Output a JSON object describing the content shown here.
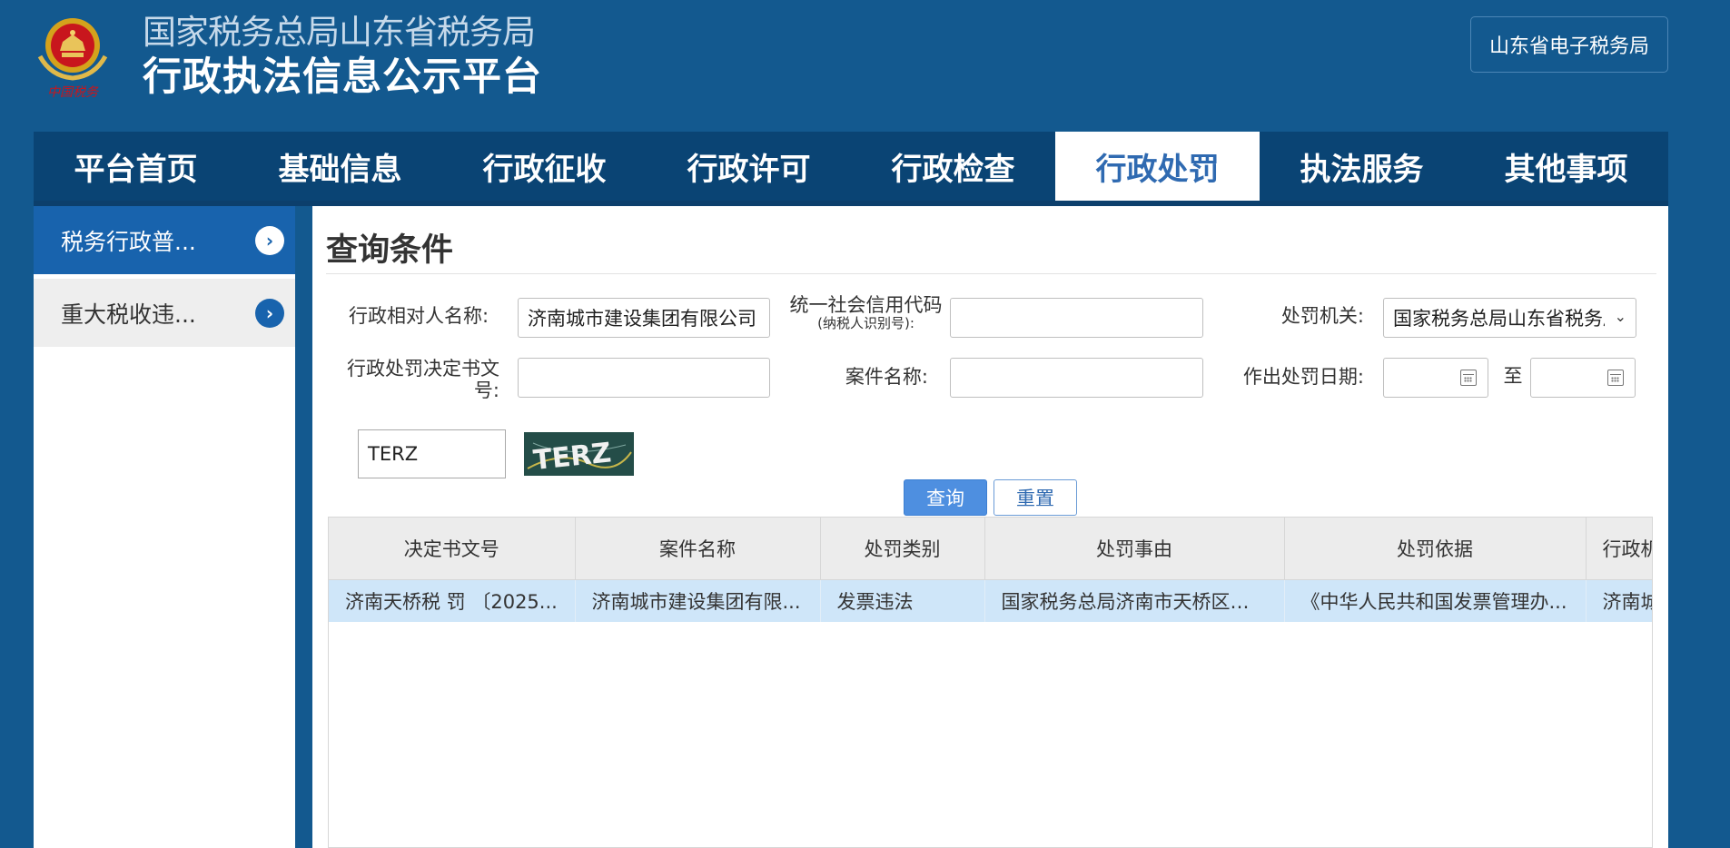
{
  "header": {
    "subtitle": "国家税务总局山东省税务局",
    "title": "行政执法信息公示平台",
    "emblem_text": "中国税务",
    "top_link": "山东省电子税务局"
  },
  "nav": {
    "items": [
      "平台首页",
      "基础信息",
      "行政征收",
      "行政许可",
      "行政检查",
      "行政处罚",
      "执法服务",
      "其他事项"
    ],
    "active": "行政处罚"
  },
  "sidebar": {
    "items": [
      {
        "label": "税务行政普..."
      },
      {
        "label": "重大税收违..."
      }
    ]
  },
  "search": {
    "title": "查询条件",
    "party_name_label": "行政相对人名称:",
    "party_name_value": "济南城市建设集团有限公司",
    "credit_code_label": "统一社会信用代码",
    "credit_code_sublabel": "(纳税人识别号):",
    "credit_code_value": "",
    "authority_label": "处罚机关:",
    "authority_value": "国家税务总局山东省税务局",
    "decision_no_label": "行政处罚决定书文号:",
    "decision_no_value": "",
    "case_name_label": "案件名称:",
    "case_name_value": "",
    "date_label": "作出处罚日期:",
    "date_separator": "至",
    "captcha_value": "TERZ",
    "captcha_image_text": "TERZ",
    "query_button": "查询",
    "reset_button": "重置"
  },
  "table": {
    "columns": [
      "决定书文号",
      "案件名称",
      "处罚类别",
      "处罚事由",
      "处罚依据",
      "行政机关"
    ],
    "rows": [
      [
        "济南天桥税 罚 〔2025...",
        "济南城市建设集团有限...",
        "发票违法",
        "国家税务总局济南市天桥区税...",
        "《中华人民共和国发票管理办...",
        "济南城..."
      ]
    ]
  },
  "colors": {
    "background": "#13598f",
    "nav": "#0a4474",
    "accent": "#1863ad",
    "row_highlight": "#cfe6f9"
  }
}
